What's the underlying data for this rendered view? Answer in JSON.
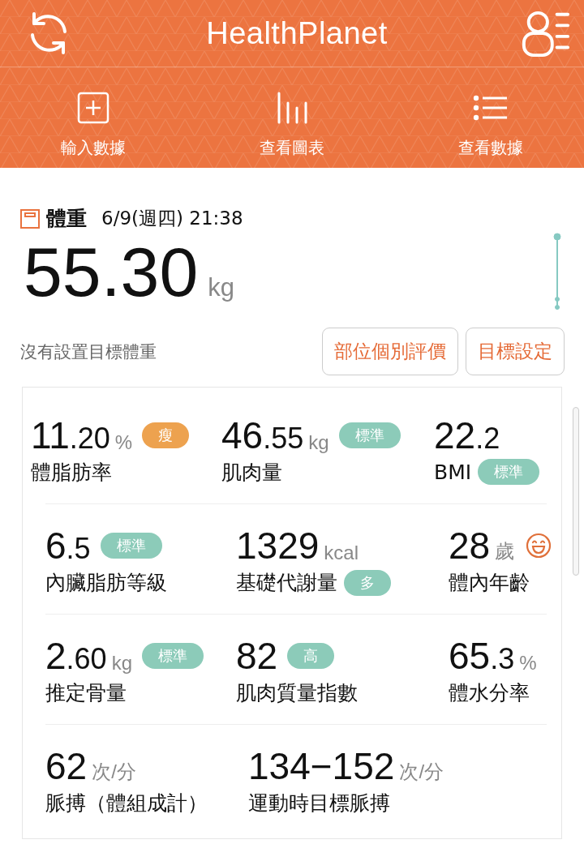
{
  "app_bar": {
    "title": "HealthPlanet"
  },
  "nav": [
    {
      "label": "輸入數據",
      "kind": "add"
    },
    {
      "label": "查看圖表",
      "kind": "chart"
    },
    {
      "label": "查看數據",
      "kind": "list"
    }
  ],
  "weight": {
    "title": "體重",
    "date": "6/9(週四) 21:38",
    "whole": "55",
    "fraction": ".30",
    "unit": "kg",
    "goal_note": "沒有設置目標體重",
    "buttons": [
      "部位個別評價",
      "目標設定"
    ]
  },
  "metric_rows": [
    [
      {
        "kind": "badge_value",
        "whole": "11",
        "fraction": ".20",
        "unit": "%",
        "label": "體脂肪率",
        "badge": {
          "text": "瘦",
          "color": "#eda24f"
        }
      },
      {
        "kind": "badge_value",
        "whole": "46",
        "fraction": ".55",
        "unit": "kg",
        "label": "肌肉量",
        "badge": {
          "text": "標準",
          "color": "#8ccbb9"
        }
      },
      {
        "kind": "badge_label",
        "whole": "22",
        "fraction": ".2",
        "label": "BMI",
        "badge": {
          "text": "標準",
          "color": "#8ccbb9"
        }
      }
    ],
    [
      {
        "kind": "badge_value",
        "whole": "6",
        "fraction": ".5",
        "label": "內臟脂肪等級",
        "badge": {
          "text": "標準",
          "color": "#8ccbb9"
        }
      },
      {
        "kind": "badge_label",
        "whole": "1329",
        "unit": "kcal",
        "label": "基礎代謝量",
        "badge": {
          "text": "多",
          "color": "#8ccbb9"
        }
      },
      {
        "kind": "face",
        "whole": "28",
        "unit": "歲",
        "label": "體內年齡"
      }
    ],
    [
      {
        "kind": "badge_value",
        "whole": "2",
        "fraction": ".60",
        "unit": "kg",
        "label": "推定骨量",
        "badge": {
          "text": "標準",
          "color": "#8ccbb9"
        }
      },
      {
        "kind": "badge_value",
        "whole": "82",
        "label": "肌肉質量指數",
        "badge": {
          "text": "高",
          "color": "#8ccbb9"
        }
      },
      {
        "kind": "plain",
        "whole": "65",
        "fraction": ".3",
        "unit": "%",
        "label": "體水分率"
      }
    ],
    [
      {
        "kind": "plain",
        "whole": "62",
        "unit": "次/分",
        "label": "脈搏（體組成計）"
      },
      {
        "kind": "plain",
        "whole": "134−152",
        "unit": "次/分",
        "label": "運動時目標脈搏"
      }
    ]
  ]
}
